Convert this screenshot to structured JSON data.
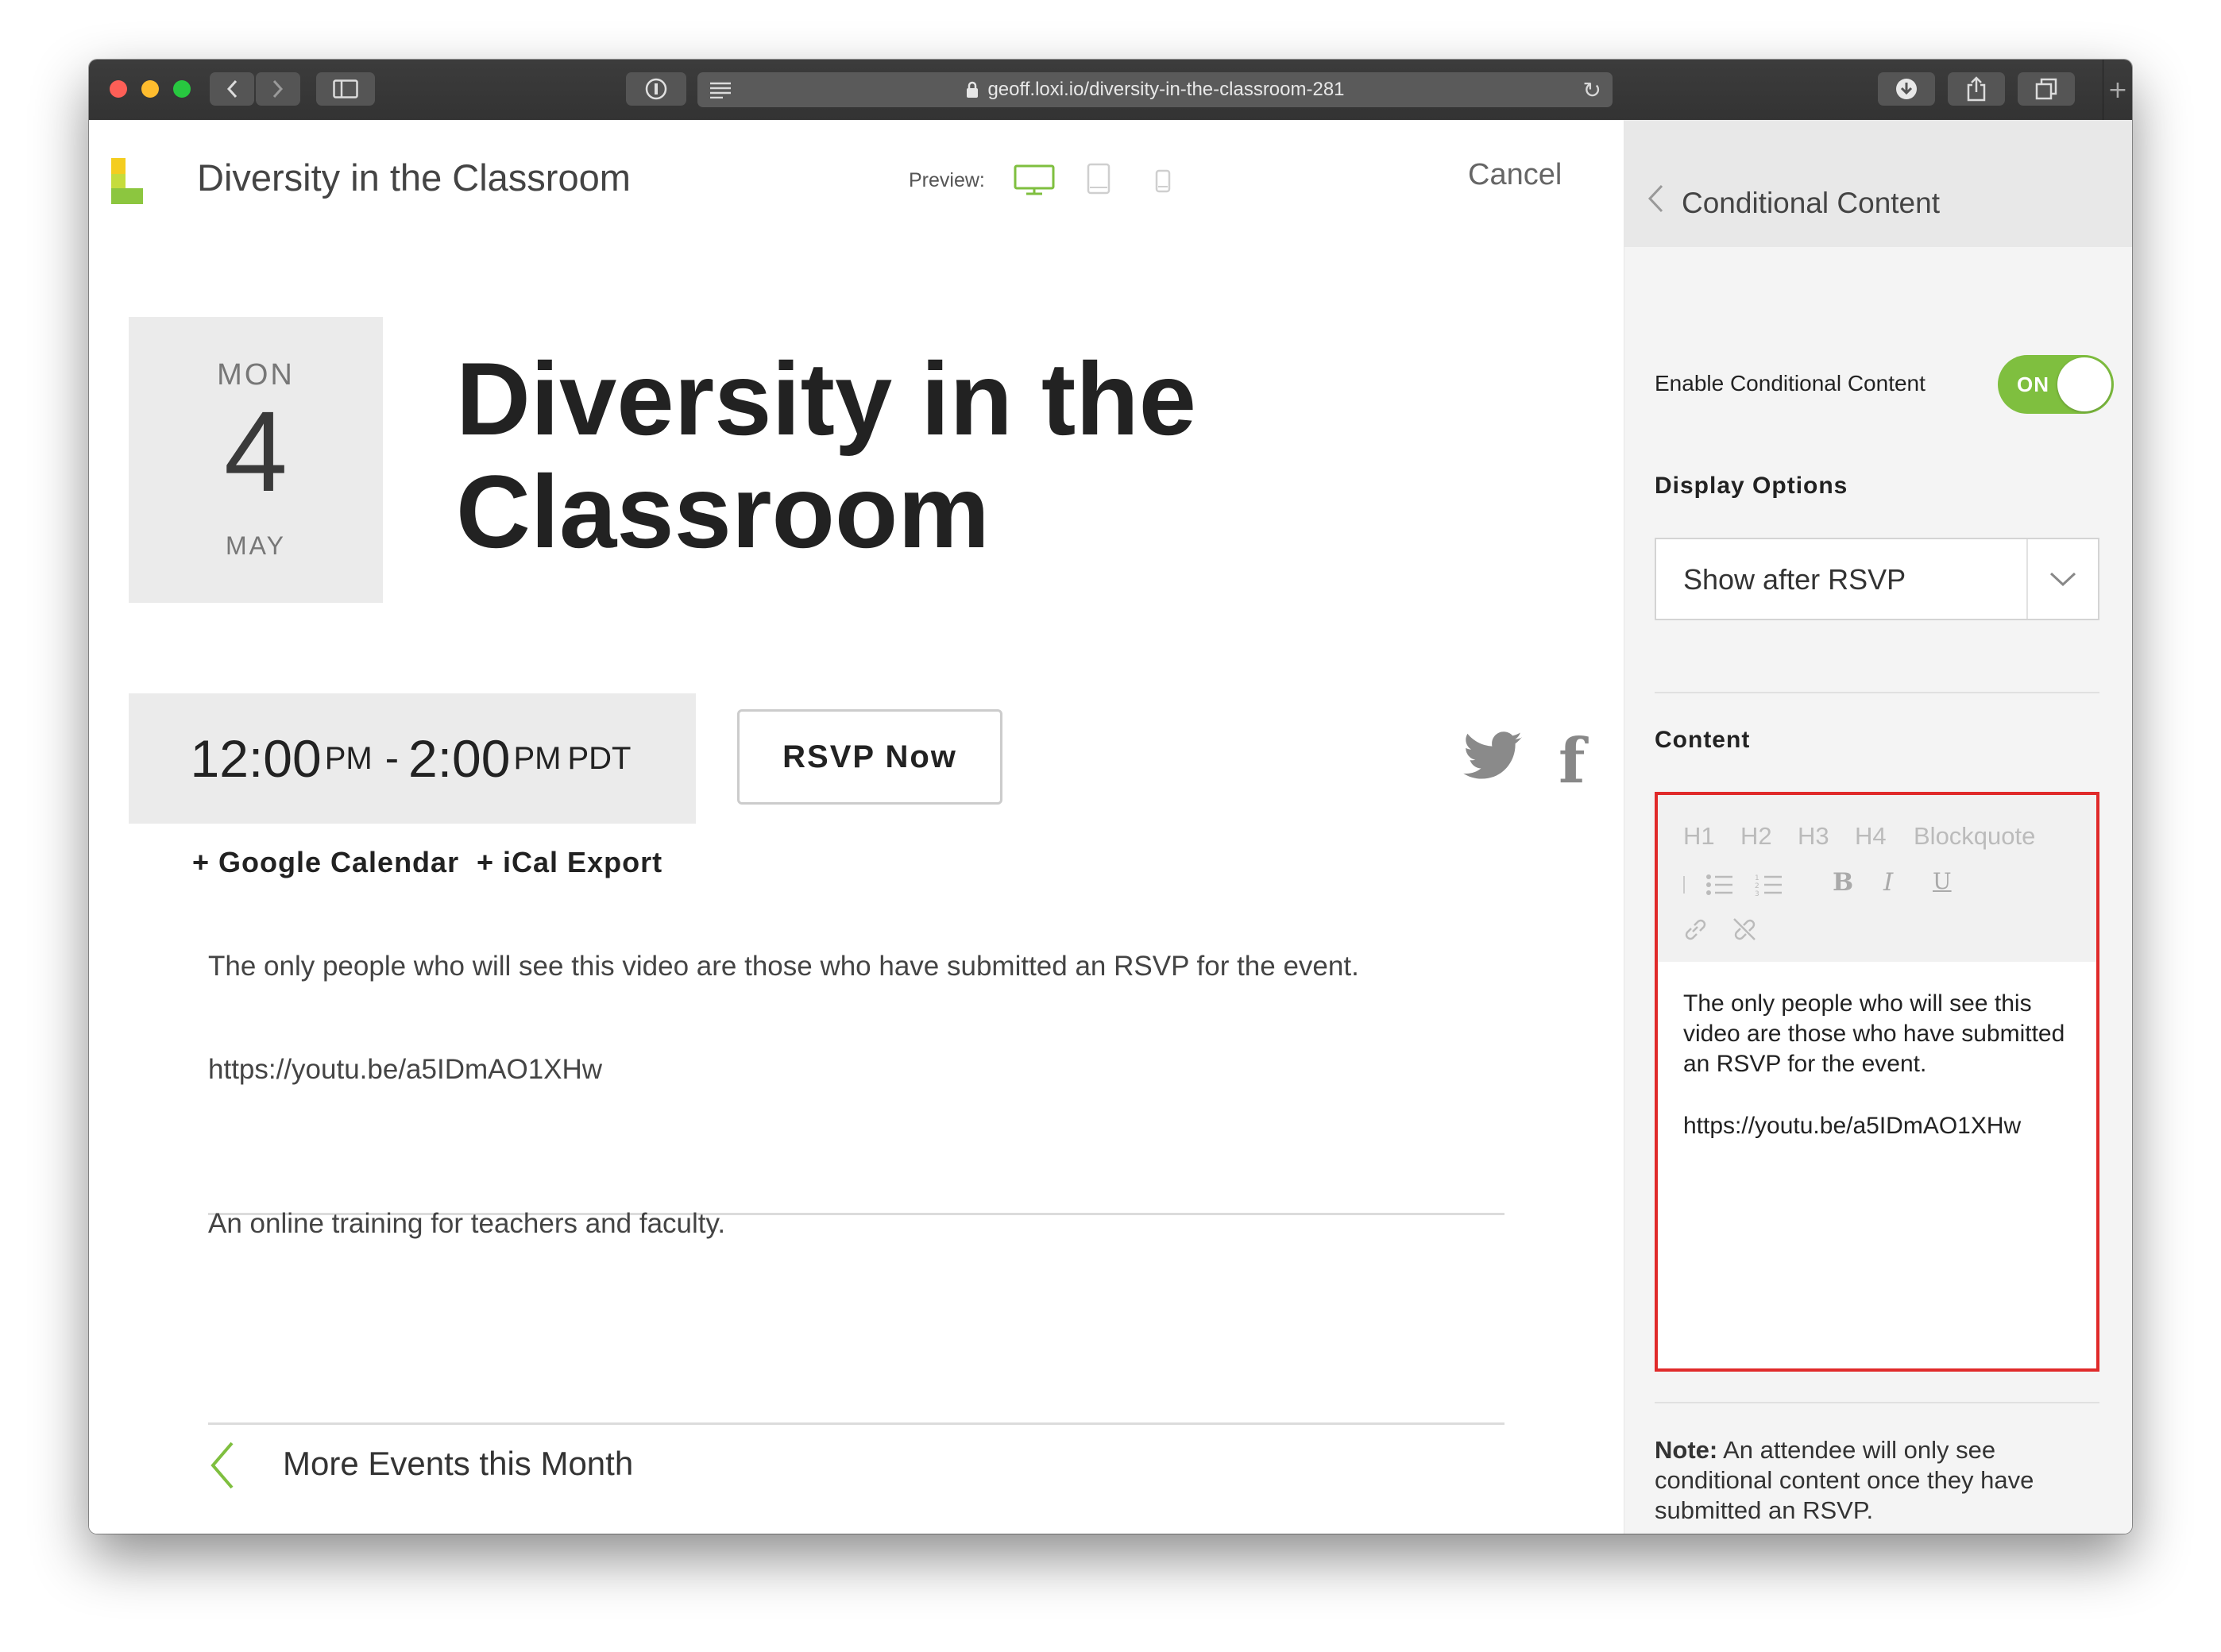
{
  "browser": {
    "url": "geoff.loxi.io/diversity-in-the-classroom-281"
  },
  "header": {
    "site_title": "Diversity in the Classroom",
    "preview_label": "Preview:",
    "cancel_label": "Cancel"
  },
  "event": {
    "dow": "MON",
    "day": "4",
    "month": "MAY",
    "title_line1": "Diversity in the",
    "title_line2": "Classroom",
    "start_time": "12:00",
    "start_ampm": "PM",
    "dash": "-",
    "end_time": "2:00",
    "end_ampm": "PM",
    "timezone": "PDT",
    "rsvp_label": "RSVP Now",
    "google_calendar": "+ Google Calendar",
    "ical_export": "+ iCal Export",
    "conditional_text": "The only people who will see this video are those who have submitted an RSVP for the event.",
    "video_link": "https://youtu.be/a5IDmAO1XHw",
    "description": "An online training for teachers and faculty.",
    "more_events": "More Events this Month"
  },
  "sidebar": {
    "title": "Conditional Content",
    "enable_label": "Enable Conditional Content",
    "toggle_label": "ON",
    "display_options_heading": "Display Options",
    "display_option_value": "Show after RSVP",
    "content_heading": "Content",
    "toolbar": {
      "h1": "H1",
      "h2": "H2",
      "h3": "H3",
      "h4": "H4",
      "blockquote": "Blockquote",
      "bold": "B",
      "italic": "I",
      "underline": "U"
    },
    "editor_text": "The only people who will see this video are those who have submitted an RSVP for the event.",
    "editor_link": "https://youtu.be/a5IDmAO1XHw",
    "note_label": "Note:",
    "note_text": " An attendee will only see conditional content once they have submitted an RSVP."
  },
  "colors": {
    "accent_green": "#7fbf3f",
    "highlight_red": "#e02a2a"
  }
}
